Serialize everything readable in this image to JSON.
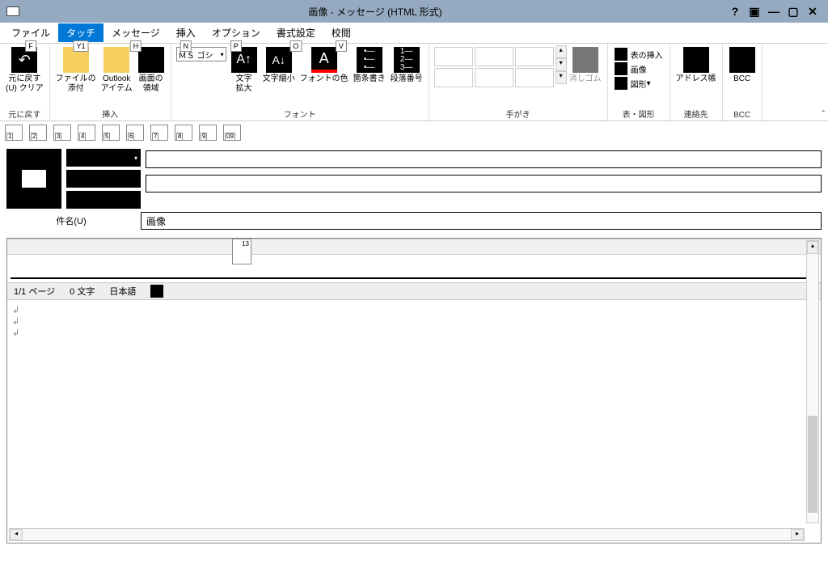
{
  "window": {
    "title": "画像 - メッセージ (HTML 形式)"
  },
  "tabs": {
    "file": "ファイル",
    "touch": "タッチ",
    "message": "メッセージ",
    "insert": "挿入",
    "option": "オプション",
    "format": "書式設定",
    "review": "校閲",
    "key_file": "F",
    "key_touch": "Y1",
    "key_message": "H",
    "key_insert": "N",
    "key_option": "P",
    "key_format": "O",
    "key_review": "V"
  },
  "ribbon": {
    "undo_label": "元に戻す\n(U) クリア",
    "undo_group": "元に戻す",
    "attach_file": "ファイルの\n添付",
    "outlook_item": "Outlook\nアイテム",
    "screen_region": "画面の\n領域",
    "insert_group": "挿入",
    "font_name": "ＭＳ ゴシ",
    "enlarge": "文字\n拡大",
    "shrink": "文字縮小",
    "font_color": "フォントの色",
    "bullets": "箇条書き",
    "numbering": "段落番号",
    "font_group": "フォント",
    "eraser": "消しゴム",
    "hand_group": "手がき",
    "insert_table": "表の挿入",
    "image": "画像",
    "shapes": "図形",
    "table_group": "表・図形",
    "address_book": "アドレス帳",
    "contacts_group": "連絡先",
    "bcc": "BCC",
    "bcc_group": "BCC"
  },
  "qat": [
    "1",
    "2",
    "3",
    "4",
    "5",
    "6",
    "7",
    "8",
    "9",
    "09"
  ],
  "header": {
    "subject_label": "件名(U)",
    "subject_value": "画像"
  },
  "ruler": {
    "marker": "13"
  },
  "status": {
    "page": "1/1 ページ",
    "chars": "0 文字",
    "lang": "日本語"
  }
}
